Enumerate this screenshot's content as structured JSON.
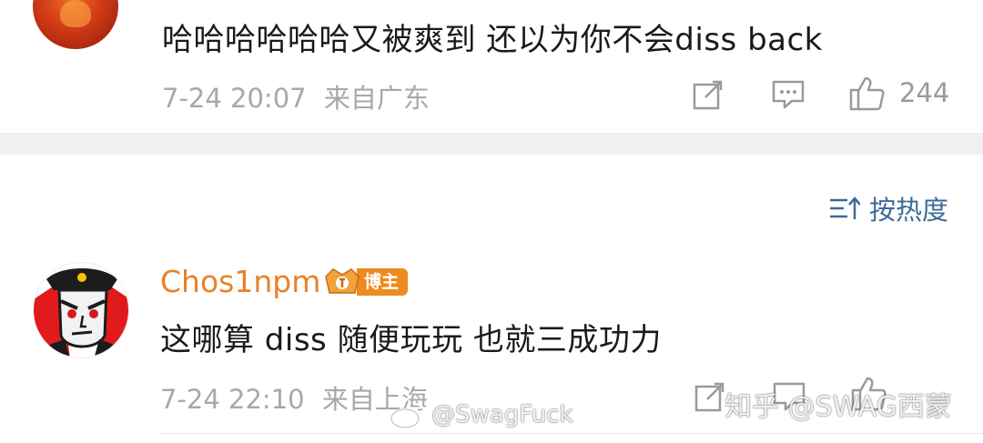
{
  "comment_1": {
    "text": "哈哈哈哈哈哈又被爽到 还以为你不会diss back",
    "time": "7-24 20:07",
    "location": "来自广东",
    "likes": "244"
  },
  "sort": {
    "label": "按热度",
    "icon": "sort-icon"
  },
  "comment_2": {
    "username": "Chos1npm",
    "badge": "博主",
    "text": "这哪算 diss 随便玩玩 也就三成功力",
    "time": "7-24 22:10",
    "location": "来自上海"
  },
  "watermarks": {
    "weibo": "@SwagFuck",
    "zhihu": "知乎 @SWAG西蒙"
  },
  "colors": {
    "username": "#e98226",
    "link": "#3d6a99",
    "meta": "#a8a8a8",
    "band": "#f0f0f2"
  }
}
